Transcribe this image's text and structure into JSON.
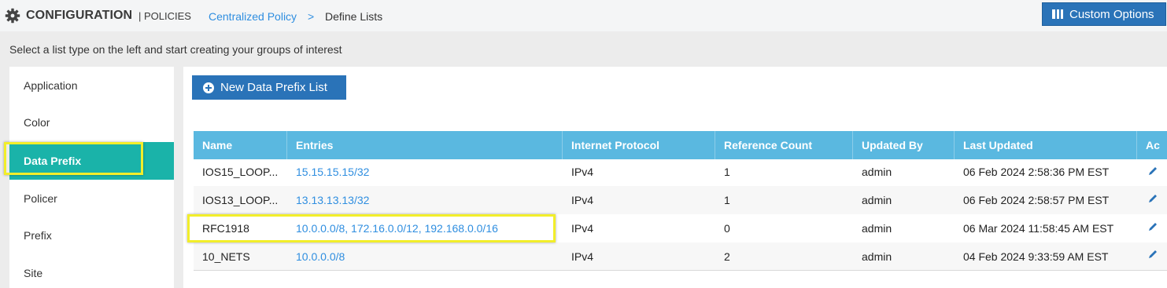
{
  "header": {
    "title": "CONFIGURATION",
    "subtitle": "| POLICIES",
    "breadcrumb_link": "Centralized Policy",
    "breadcrumb_sep": ">",
    "breadcrumb_current": "Define Lists",
    "custom_options_label": "Custom Options"
  },
  "instruction": "Select a list type on the left and start creating your groups of interest",
  "sidebar": {
    "items": [
      {
        "label": "Application"
      },
      {
        "label": "Color"
      },
      {
        "label": "Data Prefix"
      },
      {
        "label": "Policer"
      },
      {
        "label": "Prefix"
      },
      {
        "label": "Site"
      }
    ],
    "active": "Data Prefix"
  },
  "main": {
    "new_button_label": "New Data Prefix List",
    "table": {
      "columns": [
        "Name",
        "Entries",
        "Internet Protocol",
        "Reference Count",
        "Updated By",
        "Last Updated",
        "Ac"
      ],
      "rows": [
        {
          "name": "IOS15_LOOP...",
          "entries": "15.15.15.15/32",
          "protocol": "IPv4",
          "ref_count": "1",
          "updated_by": "admin",
          "last_updated": "06 Feb 2024 2:58:36 PM EST"
        },
        {
          "name": "IOS13_LOOP...",
          "entries": "13.13.13.13/32",
          "protocol": "IPv4",
          "ref_count": "1",
          "updated_by": "admin",
          "last_updated": "06 Feb 2024 2:58:57 PM EST"
        },
        {
          "name": "RFC1918",
          "entries": "10.0.0.0/8, 172.16.0.0/12, 192.168.0.0/16",
          "protocol": "IPv4",
          "ref_count": "0",
          "updated_by": "admin",
          "last_updated": "06 Mar 2024 11:58:45 AM EST"
        },
        {
          "name": "10_NETS",
          "entries": "10.0.0.0/8",
          "protocol": "IPv4",
          "ref_count": "2",
          "updated_by": "admin",
          "last_updated": "04 Feb 2024 9:33:59 AM EST"
        }
      ]
    }
  },
  "colors": {
    "accent_blue": "#2a73b8",
    "table_header": "#5ab8e0",
    "active_teal": "#1ab3a9",
    "highlight_yellow": "#f2ee2a",
    "link_blue": "#2f8ee0"
  },
  "icons": {
    "header": "gear-icon",
    "custom_options": "grid-icon",
    "new_button": "plus-circle-icon",
    "row_action": "pencil-icon"
  }
}
